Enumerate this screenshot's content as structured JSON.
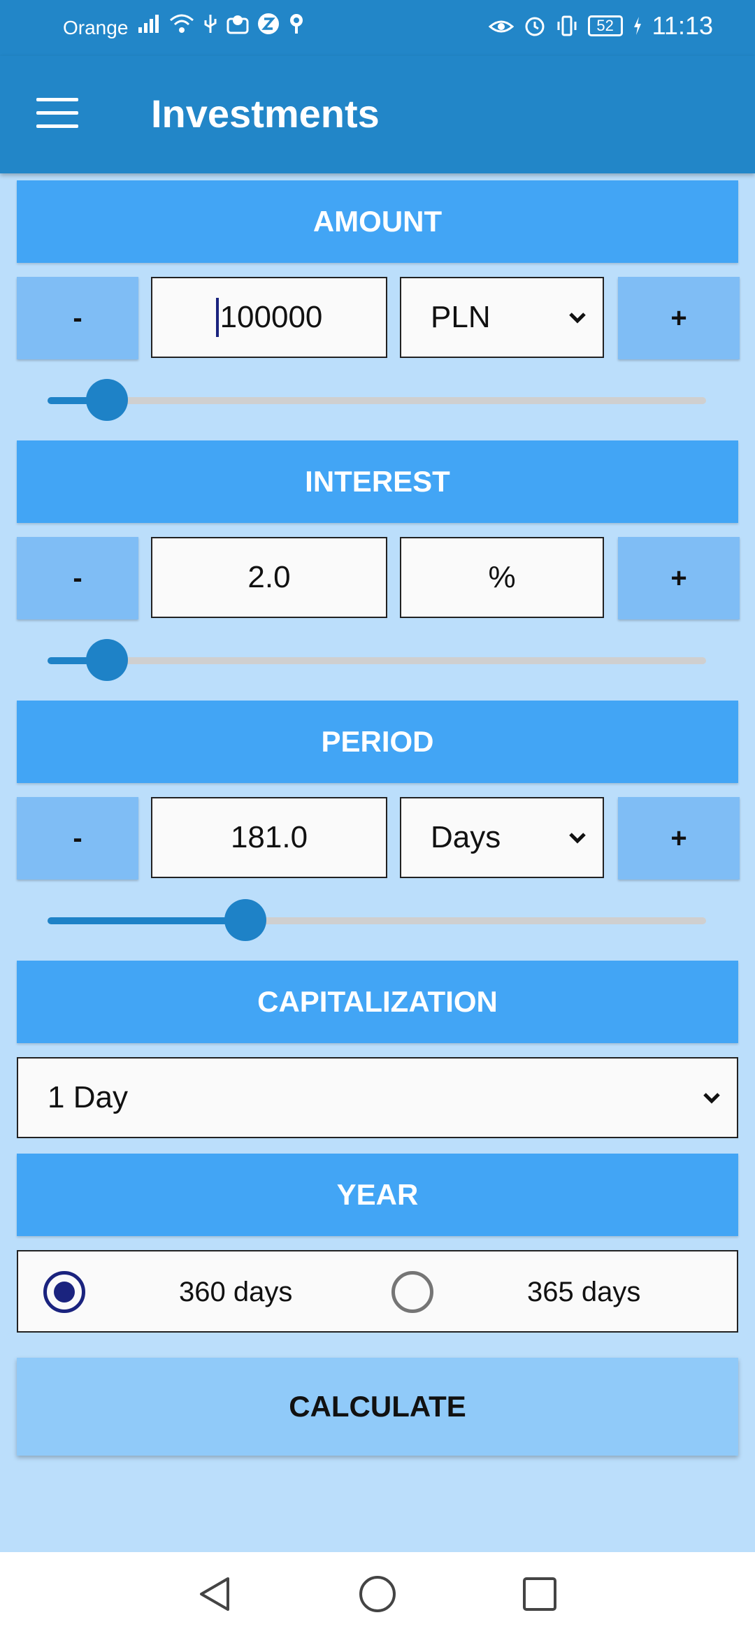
{
  "status_bar": {
    "carrier": "Orange",
    "battery": "52",
    "time": "11:13"
  },
  "app_bar": {
    "title": "Investments"
  },
  "amount": {
    "header": "AMOUNT",
    "minus_label": "-",
    "plus_label": "+",
    "value": "100000",
    "currency": "PLN",
    "slider_fraction": 0.09
  },
  "interest": {
    "header": "INTEREST",
    "minus_label": "-",
    "plus_label": "+",
    "value": "2.0",
    "unit": "%",
    "slider_fraction": 0.09
  },
  "period": {
    "header": "PERIOD",
    "minus_label": "-",
    "plus_label": "+",
    "value": "181.0",
    "unit": "Days",
    "slider_fraction": 0.3
  },
  "capitalization": {
    "header": "CAPITALIZATION",
    "selected": "1 Day"
  },
  "year": {
    "header": "YEAR",
    "options": [
      {
        "label": "360 days",
        "selected": true
      },
      {
        "label": "365 days",
        "selected": false
      }
    ]
  },
  "calculate_label": "CALCULATE",
  "colors": {
    "primary": "#2286c8",
    "header": "#42a5f5",
    "background": "#bbdefb",
    "button": "#7fbdf5",
    "accent": "#1a237e"
  }
}
